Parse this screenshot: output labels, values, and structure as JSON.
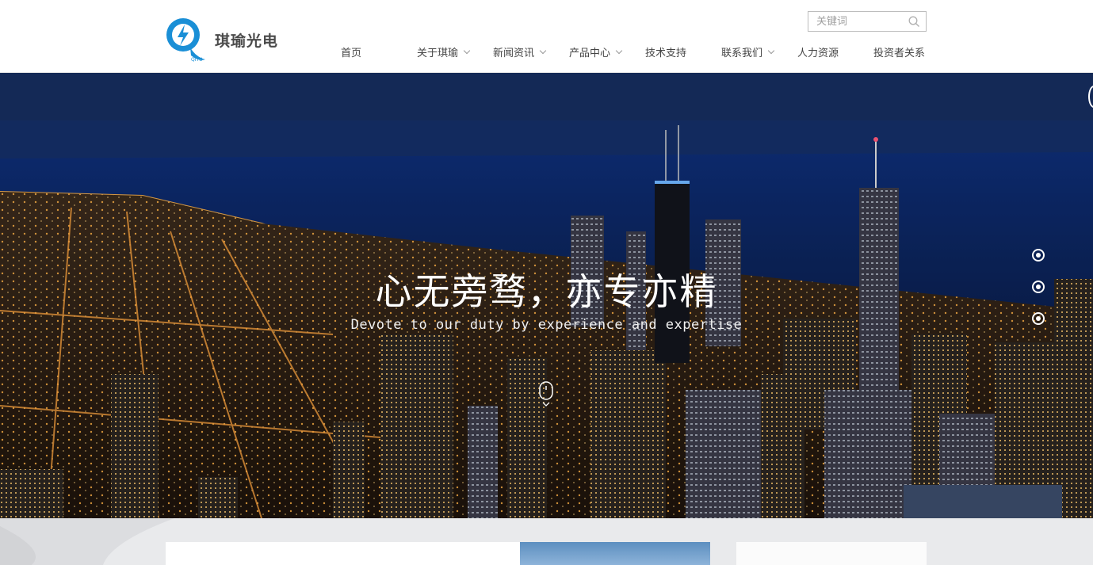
{
  "brand": {
    "name": "琪瑜光电"
  },
  "search": {
    "placeholder": "关键词"
  },
  "nav": {
    "items": [
      {
        "label": "首页"
      },
      {
        "label": "关于琪瑜"
      },
      {
        "label": "新闻资讯"
      },
      {
        "label": "产品中心"
      },
      {
        "label": "技术支持"
      },
      {
        "label": "联系我们"
      },
      {
        "label": "人力资源"
      },
      {
        "label": "投资者关系"
      }
    ]
  },
  "hero": {
    "title": "心无旁骛，亦专亦精",
    "subtitle": "Devote to our duty by experience and expertise",
    "slides": 3
  },
  "colors": {
    "brand_blue": "#1a8fd6",
    "header_bg": "#ffffff",
    "band_bg": "#e9eaec"
  }
}
